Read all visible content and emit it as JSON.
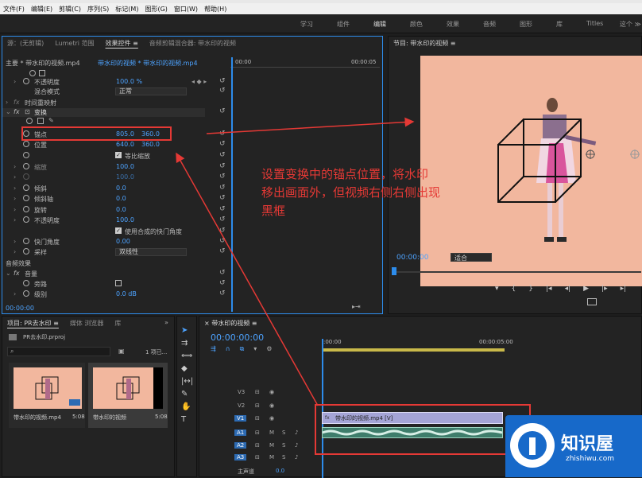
{
  "menu": [
    "文件(F)",
    "编辑(E)",
    "剪辑(C)",
    "序列(S)",
    "标记(M)",
    "图形(G)",
    "窗口(W)",
    "帮助(H)"
  ],
  "workspaces": [
    "学习",
    "组件",
    "编辑",
    "颜色",
    "效果",
    "音频",
    "图形",
    "库",
    "Titles",
    "这个 ≫"
  ],
  "effects_panel": {
    "tabs": [
      "源：(无剪辑)",
      "Lumetri 范围",
      "效果控件 ≡",
      "音频剪辑混合器: 带水印的视频"
    ],
    "clip_path": "主要 * 带水印的视频.mp4",
    "sequence_path": "带水印的视频 * 带水印的视频.mp4",
    "ruler_start": "00:00",
    "ruler_end": "00:00:05",
    "opacity_label": "不透明度",
    "opacity_value": "100.0 %",
    "blend_label": "混合模式",
    "blend_value": "正常",
    "time_remap": "时间重映射",
    "transform_label": "变换",
    "anchor_label": "锚点",
    "anchor_x": "805.0",
    "anchor_y": "360.0",
    "position_label": "位置",
    "position_x": "640.0",
    "position_y": "360.0",
    "uniform_scale": "等比缩放",
    "scale_label": "缩放",
    "scale_value": "100.0",
    "scale_width_value": "100.0",
    "skew_label": "倾斜",
    "skew_value": "0.0",
    "skew_axis_label": "倾斜轴",
    "skew_axis_value": "0.0",
    "rotation_label": "旋转",
    "rotation_value": "0.0",
    "t_opacity_label": "不透明度",
    "t_opacity_value": "100.0",
    "comp_shutter": "使用合成的快门角度",
    "shutter_label": "快门角度",
    "shutter_value": "0.00",
    "sampling_label": "采样",
    "sampling_value": "双线性",
    "audio_effects": "音频效果",
    "volume_label": "音量",
    "bypass_label": "旁路",
    "level_label": "级别",
    "level_value": "0.0 dB",
    "timecode": "00:00:00"
  },
  "program": {
    "title": "节目: 带水印的视频 ≡",
    "timecode": "00:00:00",
    "fit": "适合"
  },
  "annotation": [
    "设置变换中的锚点位置，将水印",
    "移出画面外，但视频右侧右侧出现",
    "黑框"
  ],
  "project": {
    "tabs": [
      "项目: PR去水印 ≡",
      "媒体 浏览器",
      "库"
    ],
    "file": "PR去水印.prproj",
    "count": "1 项已...",
    "items": [
      {
        "name": "带水印的视频.mp4",
        "duration": "5:08"
      },
      {
        "name": "带水印的视频",
        "duration": "5:08"
      }
    ]
  },
  "timeline": {
    "title": "带水印的视频 ≡",
    "timecode": "00:00:00:00",
    "ruler": [
      ":00:00",
      "00:00:05:00"
    ],
    "video_tracks": [
      "V3",
      "V2",
      "V1"
    ],
    "audio_tracks": [
      "A1",
      "A2",
      "A3"
    ],
    "master": "主声道",
    "master_value": "0.0",
    "clip_label": "带水印的视频.mp4 [V]"
  },
  "watermark": {
    "brand": "知识屋",
    "url": "zhishiwu.com"
  },
  "colors": {
    "accent": "#2d8ceb",
    "annotation": "#e53935",
    "clip_video": "#a4a4d6",
    "clip_audio": "#3e7d6b",
    "background_peach": "#f2b79e"
  }
}
